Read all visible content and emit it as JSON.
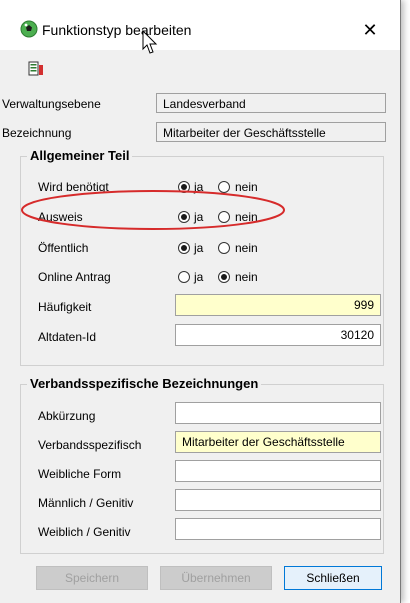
{
  "window": {
    "title": "Funktionstyp bearbeiten",
    "close_glyph": "✕"
  },
  "header": {
    "verwaltungsebene_label": "Verwaltungsebene",
    "verwaltungsebene_value": "Landesverband",
    "bezeichnung_label": "Bezeichnung",
    "bezeichnung_value": "Mitarbeiter der Geschäftsstelle"
  },
  "general": {
    "legend": "Allgemeiner Teil",
    "rows": [
      {
        "label": "Wird benötigt",
        "ja": "ja",
        "nein": "nein",
        "selected": "ja"
      },
      {
        "label": "Ausweis",
        "ja": "ja",
        "nein": "nein",
        "selected": "ja"
      },
      {
        "label": "Öffentlich",
        "ja": "ja",
        "nein": "nein",
        "selected": "ja"
      },
      {
        "label": "Online Antrag",
        "ja": "ja",
        "nein": "nein",
        "selected": "nein"
      }
    ],
    "haeufigkeit_label": "Häufigkeit",
    "haeufigkeit_value": "999",
    "altdaten_label": "Altdaten-Id",
    "altdaten_value": "30120"
  },
  "verband": {
    "legend": "Verbandsspezifische Bezeichnungen",
    "abkuerzung_label": "Abkürzung",
    "abkuerzung_value": "",
    "verbandsspezifisch_label": "Verbandsspezifisch",
    "verbandsspezifisch_value": "Mitarbeiter der Geschäftsstelle",
    "weiblich_label": "Weibliche Form",
    "weiblich_value": "",
    "maennlich_genitiv_label": "Männlich / Genitiv",
    "maennlich_genitiv_value": "",
    "weiblich_genitiv_label": "Weiblich / Genitiv",
    "weiblich_genitiv_value": ""
  },
  "buttons": {
    "speichern": "Speichern",
    "uebernehmen": "Übernehmen",
    "schliessen": "Schließen"
  },
  "colors": {
    "highlight_field": "#ffffcc",
    "annotation": "#d62b2b"
  },
  "icons": {
    "app": "football-icon",
    "toolbar": "list-icon",
    "cursor": "mouse-cursor-icon"
  }
}
